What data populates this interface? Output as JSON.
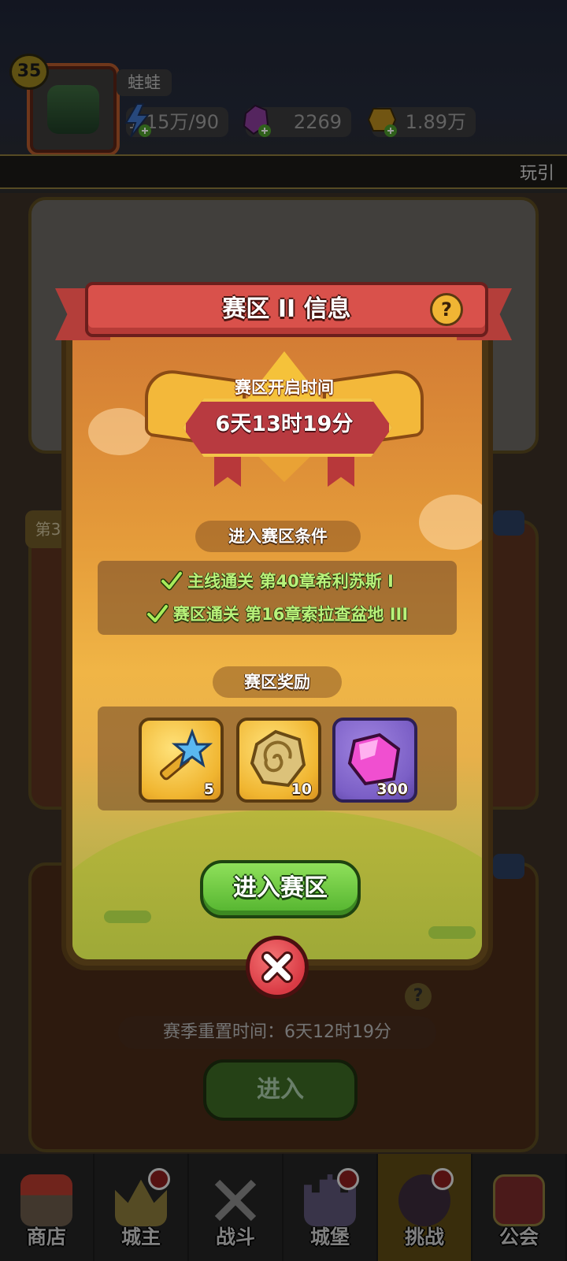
{
  "player": {
    "level": "35",
    "name": "蛙蛙",
    "energy": "1.15万/90",
    "gems": "2269",
    "gold": "1.89万"
  },
  "banner": {
    "text": "玩引"
  },
  "background": {
    "chapter_tag": "第3",
    "season_reset": "赛季重置时间：6天12时19分",
    "enter_label": "进入",
    "help_label": "?"
  },
  "modal": {
    "title": "赛区 II 信息",
    "help_label": "?",
    "open_time_label": "赛区开启时间",
    "open_time_value": "6天13时19分",
    "conditions_title": "进入赛区条件",
    "conditions": [
      "主线通关 第40章希利苏斯 I",
      "赛区通关 第16章索拉查盆地 III"
    ],
    "rewards_title": "赛区奖励",
    "rewards": [
      {
        "icon": "scepter-key-icon",
        "count": "5"
      },
      {
        "icon": "rune-stone-icon",
        "count": "10"
      },
      {
        "icon": "purple-gem-icon",
        "count": "300"
      }
    ],
    "enter_button": "进入赛区",
    "close_icon": "close-x-icon"
  },
  "nav": [
    {
      "label": "商店",
      "icon": "shop-icon",
      "badge": false,
      "active": false
    },
    {
      "label": "城主",
      "icon": "crown-icon",
      "badge": true,
      "active": false
    },
    {
      "label": "战斗",
      "icon": "crossed-swords-icon",
      "badge": false,
      "active": false
    },
    {
      "label": "城堡",
      "icon": "castle-icon",
      "badge": true,
      "active": false
    },
    {
      "label": "挑战",
      "icon": "demon-icon",
      "badge": true,
      "active": true
    },
    {
      "label": "公会",
      "icon": "guild-banner-icon",
      "badge": false,
      "active": false
    }
  ],
  "colors": {
    "ribbon_red": "#d9514b",
    "condition_green": "#b8f27a",
    "button_green": "#53b32e",
    "close_red": "#d93a44",
    "nav_active": "#5d4a14"
  }
}
